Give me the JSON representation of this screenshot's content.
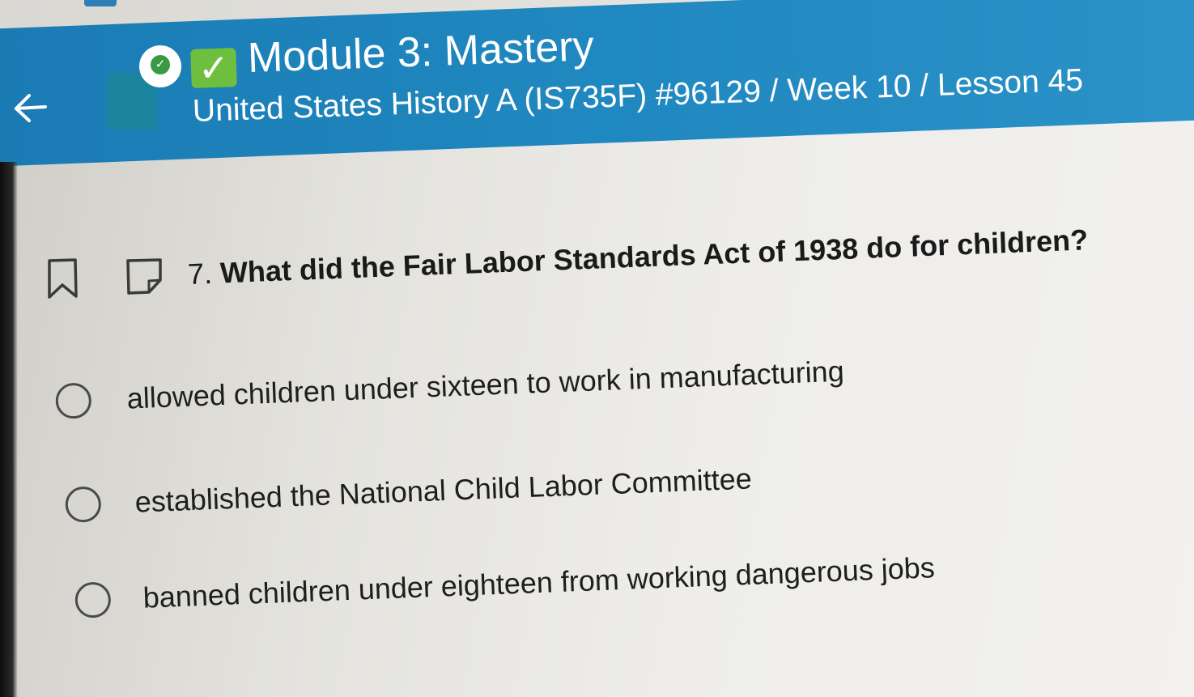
{
  "header": {
    "module_title": "Module 3: Mastery",
    "breadcrumb": "United States History A (IS735F) #96129 / Week 10 / Lesson 45",
    "back_icon": "arrow-left-icon",
    "status_icon": "check-circle-icon",
    "complete_icon": "checkbox-checked-icon",
    "accent_color": "#1b7bb4"
  },
  "question": {
    "number": "7.",
    "text": "What did the Fair Labor Standards Act of 1938 do for children?",
    "bookmark_icon": "bookmark-icon",
    "note_icon": "note-icon"
  },
  "options": [
    {
      "label": "allowed children under sixteen to work in manufacturing",
      "selected": false
    },
    {
      "label": "established the National Child Labor Committee",
      "selected": false
    },
    {
      "label": "banned children under eighteen from working dangerous jobs",
      "selected": false
    }
  ]
}
